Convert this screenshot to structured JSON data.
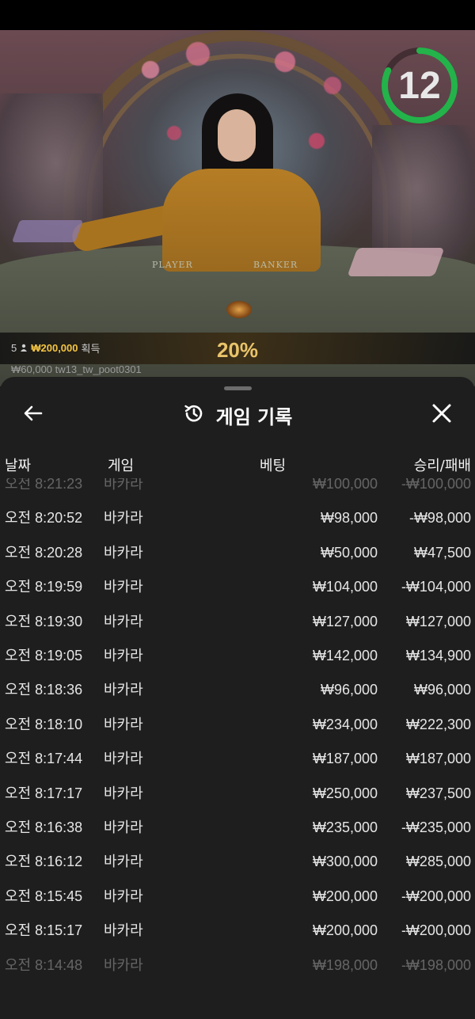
{
  "video": {
    "timer": "12",
    "timer_fraction": 0.82,
    "table_labels": {
      "player": "PLAYER",
      "banker": "BANKER"
    },
    "win_banner": {
      "count": "5",
      "user_icon": "person-icon",
      "amount": "₩200,000",
      "suffix": "획득",
      "percent": "20%"
    },
    "player_line": "₩60,000  tw13_tw_poot0301"
  },
  "sheet": {
    "title": "게임 기록",
    "title_icon": "history-icon",
    "back_icon": "arrow-left-icon",
    "close_icon": "close-icon",
    "columns": {
      "date": "날짜",
      "game": "게임",
      "bet": "베팅",
      "result": "승리/패배"
    },
    "rows": [
      {
        "date": "오전 8:21:23",
        "game": "바카라",
        "bet": "₩100,000",
        "result": "-₩100,000"
      },
      {
        "date": "오전 8:20:52",
        "game": "바카라",
        "bet": "₩98,000",
        "result": "-₩98,000"
      },
      {
        "date": "오전 8:20:28",
        "game": "바카라",
        "bet": "₩50,000",
        "result": "₩47,500"
      },
      {
        "date": "오전 8:19:59",
        "game": "바카라",
        "bet": "₩104,000",
        "result": "-₩104,000"
      },
      {
        "date": "오전 8:19:30",
        "game": "바카라",
        "bet": "₩127,000",
        "result": "₩127,000"
      },
      {
        "date": "오전 8:19:05",
        "game": "바카라",
        "bet": "₩142,000",
        "result": "₩134,900"
      },
      {
        "date": "오전 8:18:36",
        "game": "바카라",
        "bet": "₩96,000",
        "result": "₩96,000"
      },
      {
        "date": "오전 8:18:10",
        "game": "바카라",
        "bet": "₩234,000",
        "result": "₩222,300"
      },
      {
        "date": "오전 8:17:44",
        "game": "바카라",
        "bet": "₩187,000",
        "result": "₩187,000"
      },
      {
        "date": "오전 8:17:17",
        "game": "바카라",
        "bet": "₩250,000",
        "result": "₩237,500"
      },
      {
        "date": "오전 8:16:38",
        "game": "바카라",
        "bet": "₩235,000",
        "result": "-₩235,000"
      },
      {
        "date": "오전 8:16:12",
        "game": "바카라",
        "bet": "₩300,000",
        "result": "₩285,000"
      },
      {
        "date": "오전 8:15:45",
        "game": "바카라",
        "bet": "₩200,000",
        "result": "-₩200,000"
      },
      {
        "date": "오전 8:15:17",
        "game": "바카라",
        "bet": "₩200,000",
        "result": "-₩200,000"
      },
      {
        "date": "오전 8:14:48",
        "game": "바카라",
        "bet": "₩198,000",
        "result": "-₩198,000"
      }
    ]
  }
}
